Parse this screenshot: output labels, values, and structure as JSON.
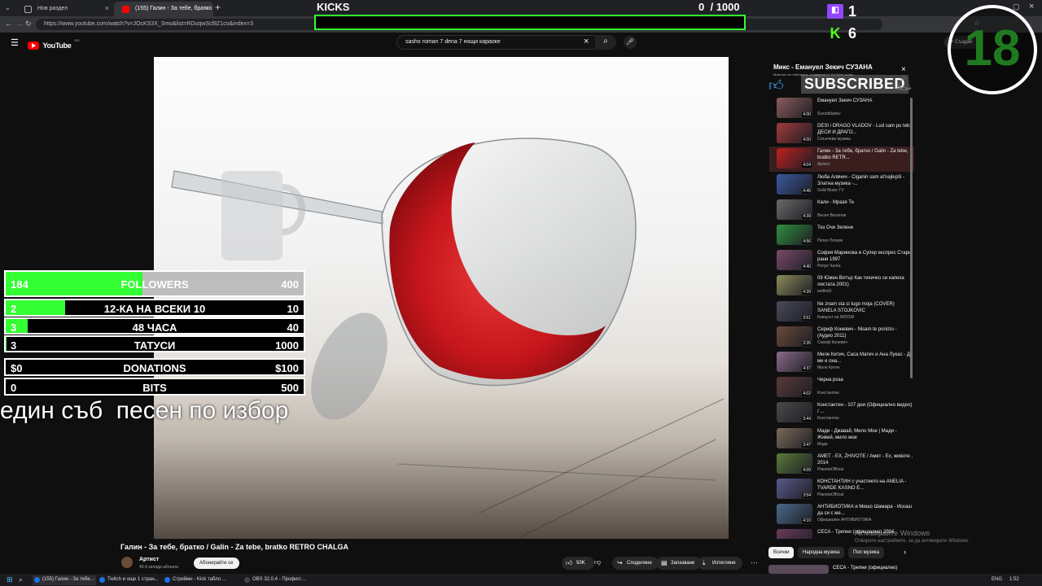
{
  "browser": {
    "tabs": [
      {
        "label": "Нов раздел"
      },
      {
        "label": "(155) Галин - За тебе, братко"
      }
    ],
    "url": "https://www.youtube.com/watch?v=JOcKS3X_Smo&list=RDuqwScl9Z1co&index=3"
  },
  "youtube": {
    "logo": "YouTube",
    "country": "BG",
    "search_query": "sasho roman 7 dena 7 нощи караоке",
    "create_label": "Създай",
    "video_title": "Галин - За тебе, братко / Galin - Za tebe, bratko RETRO CHALGA",
    "channel_name": "Артист",
    "subscribers": "49,4 хиляди абонати",
    "subscribe_label": "Абонирайте се",
    "likes": "50K",
    "share_label": "Споделяне",
    "save_label": "Запазване",
    "download_label": "Изтегляне"
  },
  "overlay": {
    "kicks_label": "KICKS",
    "kicks_count": "0",
    "kicks_goal": "/ 1000",
    "twitch_count": "1",
    "kick_count": "6",
    "age_badge": "18",
    "subscribed_label": "SUBSCRIBED",
    "followers": {
      "current": "184",
      "label": "FOLLOWERS",
      "goal": "400",
      "progress": 0.46
    },
    "goal_12ka": {
      "current": "2",
      "label": "12-КА НА ВСЕКИ 10",
      "goal": "10",
      "progress": 0.2
    },
    "goal_48h": {
      "current": "3",
      "label": "48 ЧАСА",
      "goal": "40",
      "progress": 0.075
    },
    "goal_tattoo": {
      "current": "3",
      "label": "ТАТУСИ",
      "goal": "1000",
      "progress": 0.003
    },
    "donations": {
      "current": "$0",
      "label": "DONATIONS",
      "goal": "$100"
    },
    "bits": {
      "current": "0",
      "label": "BITS",
      "goal": "500"
    },
    "ticker": "един съб  песен по избор"
  },
  "playlist": {
    "title": "Микс - Емануел Зекич СУЗАНА",
    "subtitle": "Миксове са плейлисти, създадени от YouTube за вас",
    "items": [
      {
        "title": "Емануел Зекич СУЗАНА",
        "channel": "Svezdidubev",
        "duration": "4:00"
      },
      {
        "title": "DESI i DRAGO VLADOV - Lud sam po teb / ДЕСИ И ДРАГО...",
        "channel": "Слънчева музика",
        "duration": "4:00"
      },
      {
        "title": "Галин - За тебе, братко / Galin - Za tebe, bratko RETR...",
        "channel": "Артист",
        "duration": "4:04"
      },
      {
        "title": "Люба Алвчич - Ciganin sam al'najlepši - Златна музика -...",
        "channel": "Gold Music TV",
        "duration": "4:45"
      },
      {
        "title": "Кали - Мразя Те",
        "channel": "Весел Весинов",
        "duration": "4:39"
      },
      {
        "title": "Тез Очи Зелени",
        "channel": "Петко Петков",
        "duration": "4:56"
      },
      {
        "title": "София Маринова и Супер експрес Стари рани 1997",
        "channel": "Ретро Чалга",
        "duration": "4:40"
      },
      {
        "title": "09 Южен Вятър Как тихичко си капеха листата 2001)",
        "channel": "sedlod1",
        "duration": "4:39"
      },
      {
        "title": "Ne znam sta si tugo moja (COVER) SANELA STOJKOVIC",
        "channel": "Кавърът на WOOW",
        "duration": "3:51"
      },
      {
        "title": "Сериф Коневич - Nisam te ponizio - (Аудио 2011)",
        "channel": "Сериф Коневич",
        "duration": "3:35"
      },
      {
        "title": "Миле Китич, Саса Матич и Ана Лукас - Да ме е она...",
        "channel": "Миле Китич",
        "duration": "4:37"
      },
      {
        "title": "Черна роза",
        "channel": "Константин",
        "duration": "4:02"
      },
      {
        "title": "Константин - 107 дни (Официално видео) / ...",
        "channel": "Константин",
        "duration": "3:44"
      },
      {
        "title": "Мади - Джавай, Мило Мое | Мади - Живей, мило мое",
        "channel": "Мади",
        "duration": "3:47"
      },
      {
        "title": "АМЕТ - ЕХ, ZHIVOTE / Амет - Ех, животе , 2014",
        "channel": "PlanetaOfficial",
        "duration": "4:09"
      },
      {
        "title": "КОНСТАНТИН с участието на ANELIA - TVARDE KASNO E...",
        "channel": "PlanetaOfficial",
        "duration": "3:54"
      },
      {
        "title": "АНТИБИОТИКА и Мишо Шамара - Искаш да си с ме...",
        "channel": "Официален АНТИБИОТИКА",
        "duration": "4:10"
      },
      {
        "title": "СЕСА - Трепни (официално) 2016",
        "channel": "",
        "duration": "3:32"
      }
    ],
    "chips": [
      "Всички",
      "Народна музика",
      "Поп музика"
    ],
    "next_title": "СЕСА - Трепни (официално)"
  },
  "windows": {
    "activate_title": "Активирайте Windows",
    "activate_sub": "Отворете настройките, за да активирате Windows."
  },
  "taskbar": {
    "items": [
      "(155) Галин - За тебе...",
      "Twitch и още 1 стран...",
      "Стриймн - Kick табло ...",
      "OBS 32.0.4 - Профил:..."
    ],
    "lang": "ENG",
    "time": "1:52"
  },
  "colors": {
    "green": "#33ff33",
    "youtube_red": "#ff0000",
    "twitch": "#9146ff",
    "kick": "#53fc18"
  }
}
